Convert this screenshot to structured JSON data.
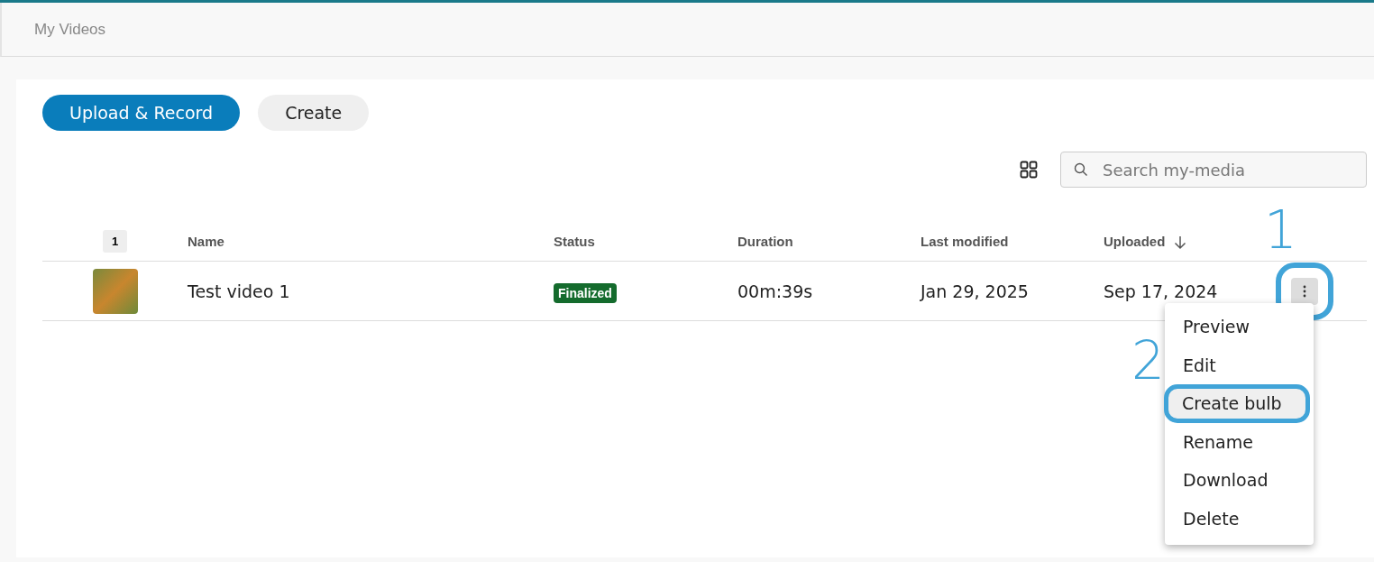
{
  "header": {
    "title": "My Videos"
  },
  "actions": [
    {
      "label": "Upload & Record",
      "kind": "primary"
    },
    {
      "label": "Create",
      "kind": "secondary"
    }
  ],
  "search": {
    "placeholder": "Search my-media"
  },
  "table": {
    "selection_count": "1",
    "columns": [
      {
        "label": "Name",
        "sorted": false
      },
      {
        "label": "Status",
        "sorted": false
      },
      {
        "label": "Duration",
        "sorted": false
      },
      {
        "label": "Last modified",
        "sorted": false
      },
      {
        "label": "Uploaded",
        "sorted": true
      }
    ],
    "rows": [
      {
        "name": "Test video 1",
        "status": "Finalized",
        "duration": "00m:39s",
        "last_modified": "Jan 29, 2025",
        "uploaded": "Sep 17, 2024"
      }
    ]
  },
  "row_menu": {
    "items": [
      {
        "label": "Preview",
        "selected": false
      },
      {
        "label": "Edit",
        "selected": false
      },
      {
        "label": "Create bulb",
        "selected": true
      },
      {
        "label": "Rename",
        "selected": false
      },
      {
        "label": "Download",
        "selected": false
      },
      {
        "label": "Delete",
        "selected": false
      }
    ]
  },
  "callouts": [
    {
      "number": "1"
    },
    {
      "number": "2"
    }
  ]
}
